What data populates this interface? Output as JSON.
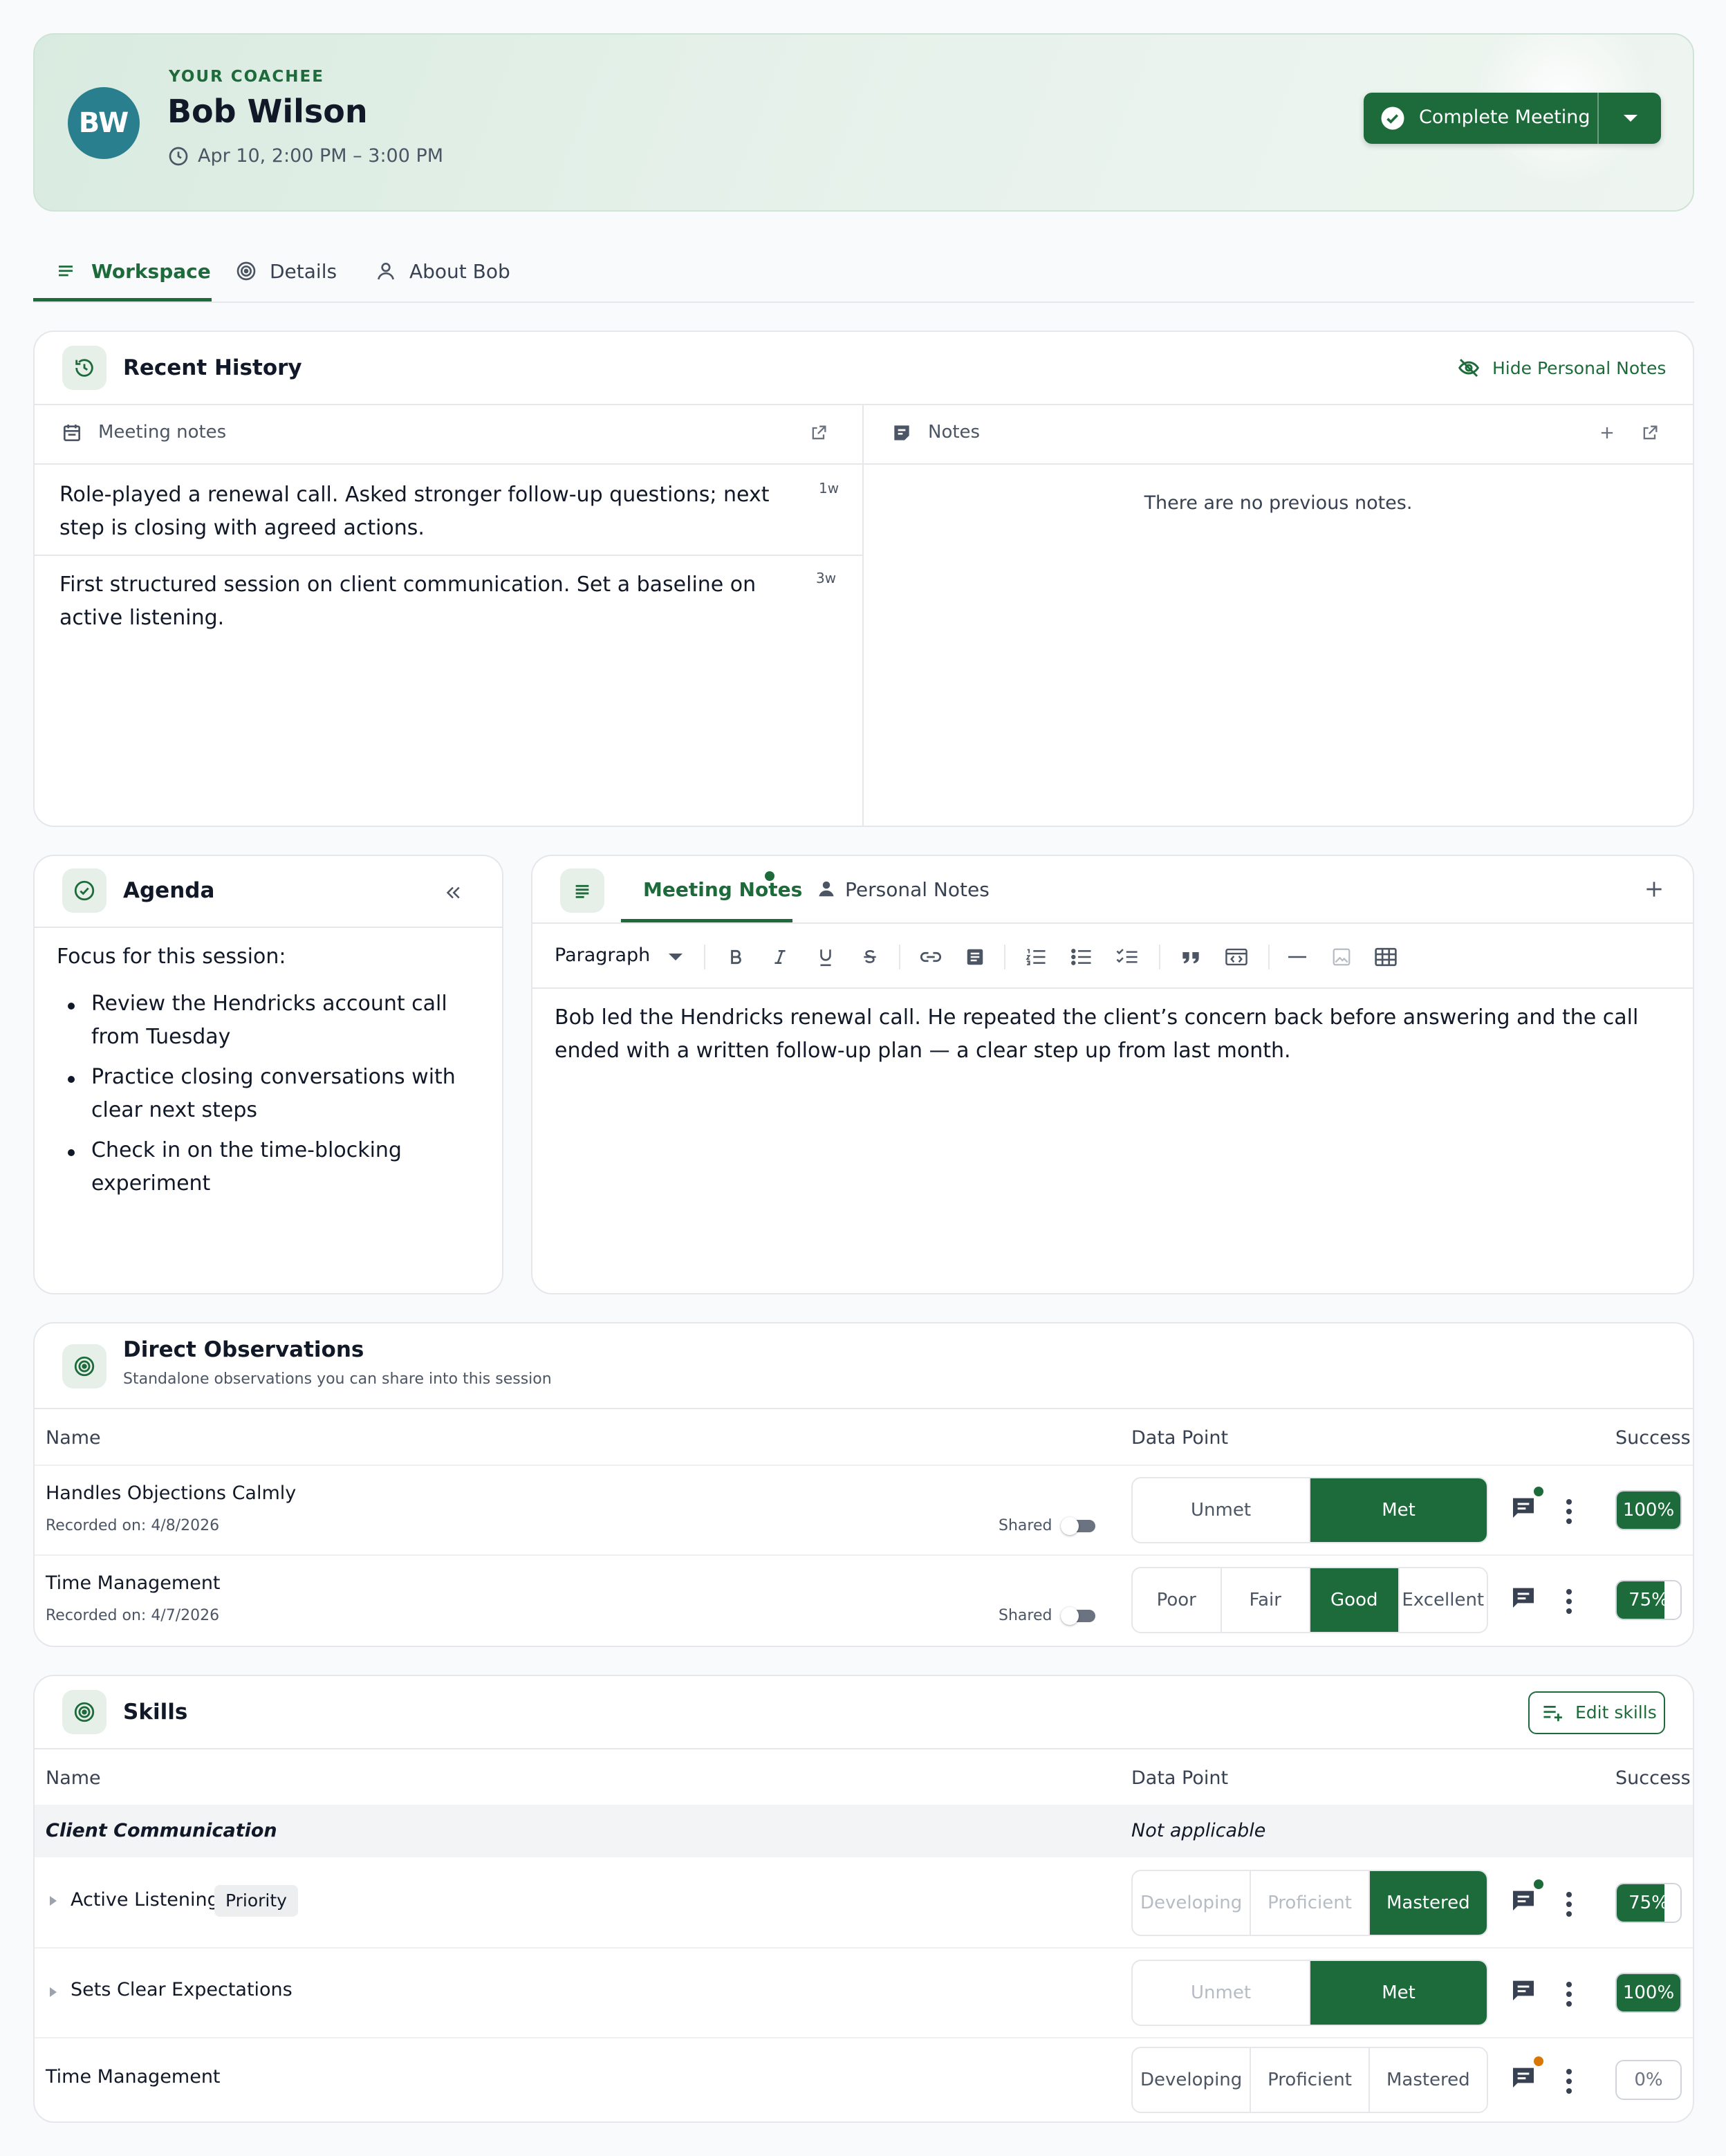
{
  "header": {
    "initials": "BW",
    "eyebrow": "YOUR COACHEE",
    "name": "Bob Wilson",
    "time": "Apr 10, 2:00 PM – 3:00 PM",
    "complete_label": "Complete Meeting"
  },
  "tabs": [
    {
      "label": "Workspace",
      "active": true
    },
    {
      "label": "Details"
    },
    {
      "label": "About Bob"
    }
  ],
  "recent_history": {
    "title": "Recent History",
    "hide_label": "Hide Personal Notes",
    "meeting_notes": {
      "label": "Meeting notes",
      "items": [
        {
          "text": "Role-played a renewal call. Asked stronger follow-up questions; next step is closing with agreed actions.",
          "age": "1w"
        },
        {
          "text": "First structured session on client communication. Set a baseline on active listening.",
          "age": "3w"
        }
      ]
    },
    "notes": {
      "label": "Notes",
      "empty": "There are no previous notes."
    }
  },
  "agenda": {
    "title": "Agenda",
    "intro": "Focus for this session:",
    "items": [
      "Review the Hendricks account call from Tuesday",
      "Practice closing conversations with clear next steps",
      "Check in on the time-blocking experiment"
    ]
  },
  "editor": {
    "tabs": [
      {
        "label": "Meeting Notes",
        "active": true
      },
      {
        "label": "Personal Notes"
      }
    ],
    "block_type": "Paragraph",
    "content": "Bob led the Hendricks renewal call. He repeated the client’s concern back before answering and the call ended with a written follow-up plan — a clear step up from last month."
  },
  "observations": {
    "title": "Direct Observations",
    "subtitle": "Standalone observations you can share into this session",
    "columns": {
      "name": "Name",
      "data_point": "Data Point",
      "success": "Success"
    },
    "rows": [
      {
        "name": "Handles Objections Calmly",
        "recorded": "Recorded on: 4/8/2026",
        "shared_label": "Shared",
        "options": [
          "Unmet",
          "Met"
        ],
        "selected": 1,
        "success": 100,
        "success_label": "100%",
        "comment_dot": "#1d6b3a"
      },
      {
        "name": "Time Management",
        "recorded": "Recorded on: 4/7/2026",
        "shared_label": "Shared",
        "options": [
          "Poor",
          "Fair",
          "Good",
          "Excellent"
        ],
        "selected": 2,
        "success": 75,
        "success_label": "75%",
        "comment_dot": null
      }
    ]
  },
  "skills": {
    "title": "Skills",
    "edit_label": "Edit skills",
    "columns": {
      "name": "Name",
      "data_point": "Data Point",
      "success": "Success"
    },
    "group": {
      "name": "Client Communication",
      "data_point": "Not applicable"
    },
    "rows": [
      {
        "name": "Active Listening",
        "badge": "Priority",
        "expandable": true,
        "options": [
          "Developing",
          "Proficient",
          "Mastered"
        ],
        "selected": 2,
        "dim": true,
        "success": 75,
        "success_label": "75%",
        "comment_dot": "#1d6b3a"
      },
      {
        "name": "Sets Clear Expectations",
        "expandable": true,
        "options": [
          "Unmet",
          "Met"
        ],
        "selected": 1,
        "dim": true,
        "success": 100,
        "success_label": "100%",
        "comment_dot": null
      },
      {
        "name": "Time Management",
        "expandable": false,
        "options": [
          "Developing",
          "Proficient",
          "Mastered"
        ],
        "selected": -1,
        "dim": false,
        "success": 0,
        "success_label": "0%",
        "comment_dot": "#d97706"
      }
    ]
  },
  "colors": {
    "primary": "#1d6b3a",
    "avatar": "#2a7f8f",
    "header_bg": "#dfeee4"
  }
}
